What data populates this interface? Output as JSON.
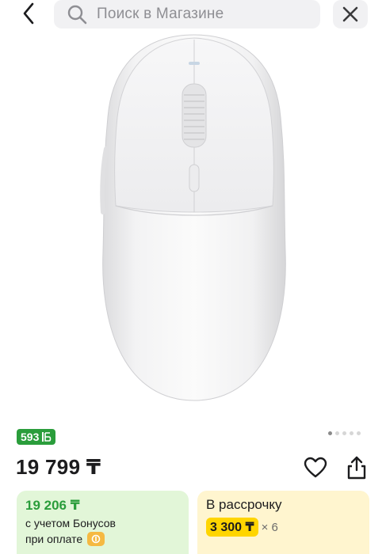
{
  "search": {
    "placeholder": "Поиск в Магазине"
  },
  "product": {
    "bonus_points": "593",
    "price": "19 799 ₸",
    "gallery": {
      "total": 5,
      "active": 1
    }
  },
  "offers": {
    "bonus_price": "19 206 ₸",
    "bonus_line1": "с учетом Бонусов",
    "bonus_line2": "при оплате",
    "installment_title": "В рассрочку",
    "installment_amount": "3 300 ₸",
    "installment_multiplier": "× 6"
  },
  "colors": {
    "bonus_green": "#2a9d3b",
    "installment_yellow": "#ffd500"
  },
  "icons": [
    "back-arrow-icon",
    "search-icon",
    "close-icon",
    "heart-icon",
    "share-icon",
    "bonus-b-icon",
    "pay-icon"
  ]
}
